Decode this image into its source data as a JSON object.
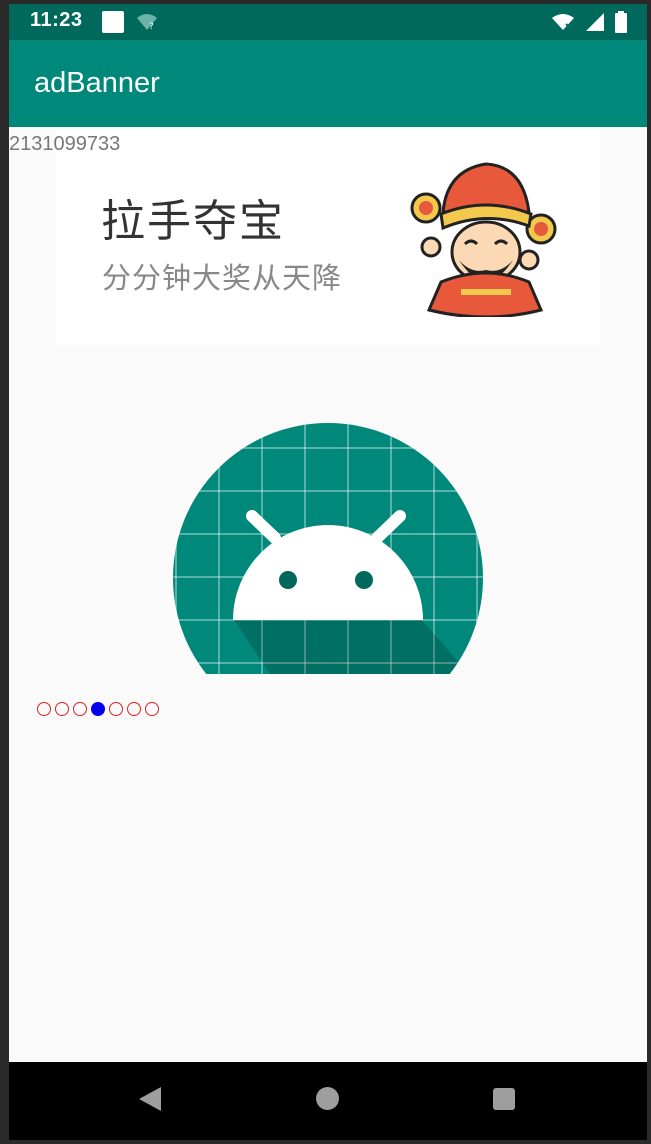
{
  "status_bar": {
    "time": "11:23",
    "icons": [
      "notification-icon",
      "wifi-unknown-icon",
      "wifi-icon",
      "signal-icon",
      "battery-icon"
    ]
  },
  "app_bar": {
    "title": "adBanner"
  },
  "content": {
    "resource_id": "2131099733"
  },
  "banner": {
    "title": "拉手夺宝",
    "subtitle": "分分钟大奖从天降",
    "mascot": "god-of-wealth-icon"
  },
  "carousel": {
    "current_image": "android-launcher-icon",
    "indicator_count": 7,
    "active_index": 3
  },
  "colors": {
    "status_bar": "#00695c",
    "app_bar": "#00897b",
    "indicator_inactive": "#e02020",
    "indicator_active": "#0000ee"
  },
  "nav_bar": {
    "buttons": [
      "back-icon",
      "home-icon",
      "recents-icon"
    ]
  }
}
